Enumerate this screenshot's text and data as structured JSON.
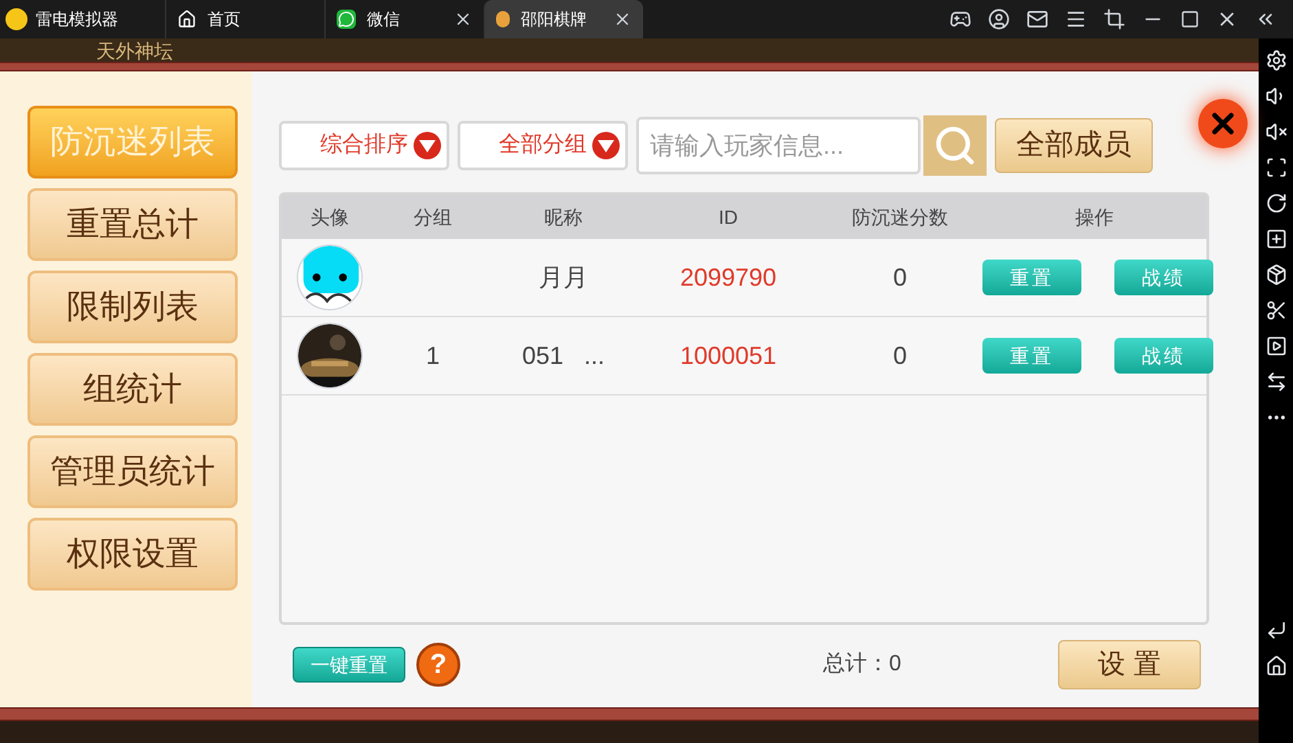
{
  "emulator": {
    "app_name": "雷电模拟器",
    "tabs": [
      {
        "label": "首页",
        "selected": false,
        "closable": false,
        "kind": "home"
      },
      {
        "label": "微信",
        "selected": false,
        "closable": true,
        "kind": "chat"
      },
      {
        "label": "邵阳棋牌",
        "selected": true,
        "closable": true,
        "kind": "game"
      }
    ]
  },
  "background": {
    "title": "天外神坛"
  },
  "menu": [
    {
      "label": "防沉迷列表",
      "selected": true
    },
    {
      "label": "重置总计",
      "selected": false
    },
    {
      "label": "限制列表",
      "selected": false
    },
    {
      "label": "组统计",
      "selected": false
    },
    {
      "label": "管理员统计",
      "selected": false
    },
    {
      "label": "权限设置",
      "selected": false
    }
  ],
  "filters": [
    {
      "label": "综合排序"
    },
    {
      "label": "全部分组"
    }
  ],
  "search": {
    "placeholder": "请输入玩家信息..."
  },
  "all_members_button": "全部成员",
  "table": {
    "columns": [
      "头像",
      "分组",
      "昵称",
      "ID",
      "防沉迷分数",
      "操作"
    ],
    "rows": [
      {
        "nickname": "月月",
        "id": "2099790",
        "score": "0",
        "actions": [
          "重置",
          "战绩"
        ]
      },
      {
        "group": "1",
        "nickname": "051   ...",
        "id": "1000051",
        "score": "0",
        "actions": [
          "重置",
          "战绩"
        ]
      }
    ]
  },
  "footer": {
    "reset_all": "一键重置",
    "help": "?",
    "total": "总计：0",
    "settings": "设 置"
  }
}
